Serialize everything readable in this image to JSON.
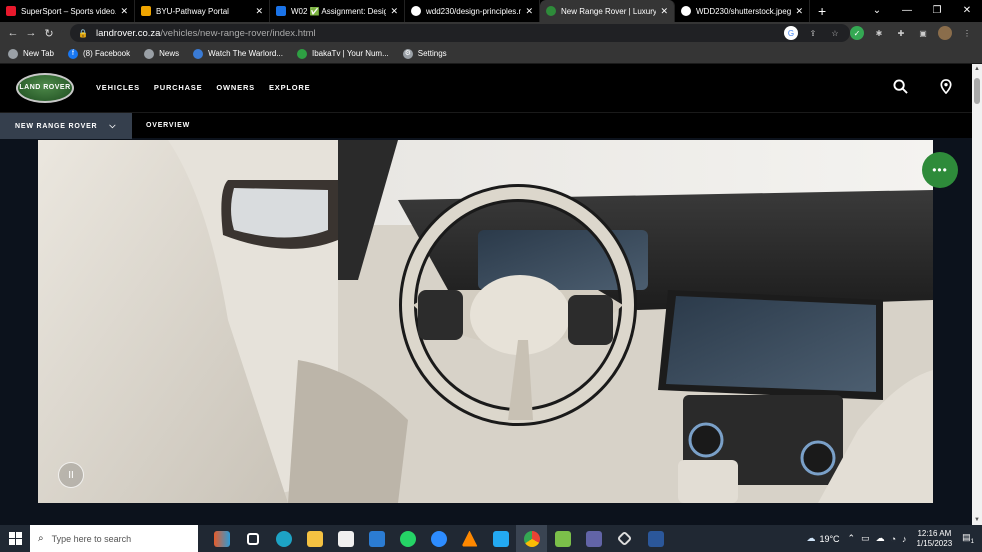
{
  "browser": {
    "tabs": [
      {
        "title": "SuperSport – Sports video...",
        "color": "#e8192c",
        "active": false
      },
      {
        "title": "BYU-Pathway Portal",
        "color": "#f0a500",
        "active": false
      },
      {
        "title": "W02 ✅ Assignment: Desig...",
        "color": "#1a73e8",
        "active": false
      },
      {
        "title": "wdd230/design-principles.m...",
        "color": "#ffffff",
        "active": false
      },
      {
        "title": "New Range Rover | Luxury...",
        "color": "#3b3b3b",
        "active": true
      },
      {
        "title": "WDD230/shutterstock.jpeg...",
        "color": "#ffffff",
        "active": false
      }
    ],
    "url_domain": "landrover.co.za",
    "url_path": "/vehicles/new-range-rover/index.html",
    "bookmarks": [
      {
        "label": "New Tab",
        "color": "#9aa0a6"
      },
      {
        "label": "(8) Facebook",
        "color": "#1877f2"
      },
      {
        "label": "News",
        "color": "#9aa0a6"
      },
      {
        "label": "Watch The Warlord...",
        "color": "#3a7bd5"
      },
      {
        "label": "IbakaTv | Your Num...",
        "color": "#2ea043"
      },
      {
        "label": "Settings",
        "color": "#9aa0a6"
      }
    ]
  },
  "site": {
    "logo_text": "LAND ROVER",
    "nav": [
      "VEHICLES",
      "PURCHASE",
      "OWNERS",
      "EXPLORE"
    ],
    "subnav_selected": "NEW RANGE ROVER",
    "subnav_link": "OVERVIEW",
    "chat_label": "•••",
    "pause_label": "II",
    "brand_green": "#2e8b3a"
  },
  "taskbar": {
    "search_placeholder": "Type here to search",
    "weather": "19°C",
    "time": "12:16 AM",
    "date": "1/15/2023",
    "notifications": "1"
  }
}
